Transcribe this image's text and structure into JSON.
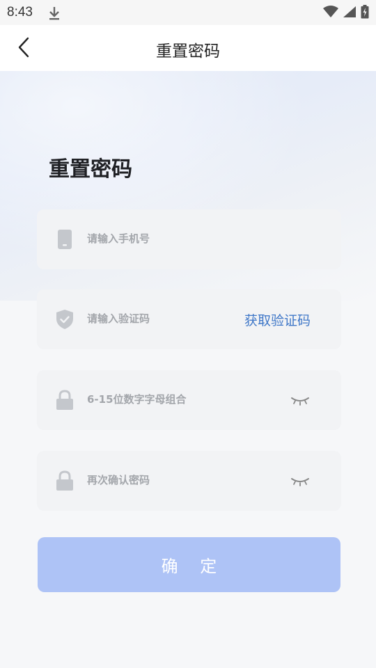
{
  "status_bar": {
    "time": "8:43"
  },
  "app_bar": {
    "title": "重置密码"
  },
  "heading": "重置密码",
  "fields": {
    "phone": {
      "placeholder": "请输入手机号"
    },
    "code": {
      "placeholder": "请输入验证码",
      "action": "获取验证码"
    },
    "password": {
      "placeholder": "6-15位数字字母组合"
    },
    "confirm_password": {
      "placeholder": "再次确认密码"
    }
  },
  "confirm_button": {
    "label": "确 定"
  },
  "colors": {
    "accent": "#3f77c8",
    "button_bg": "#aec3f6",
    "field_bg": "#f2f3f5",
    "placeholder": "#a3a6ab"
  }
}
